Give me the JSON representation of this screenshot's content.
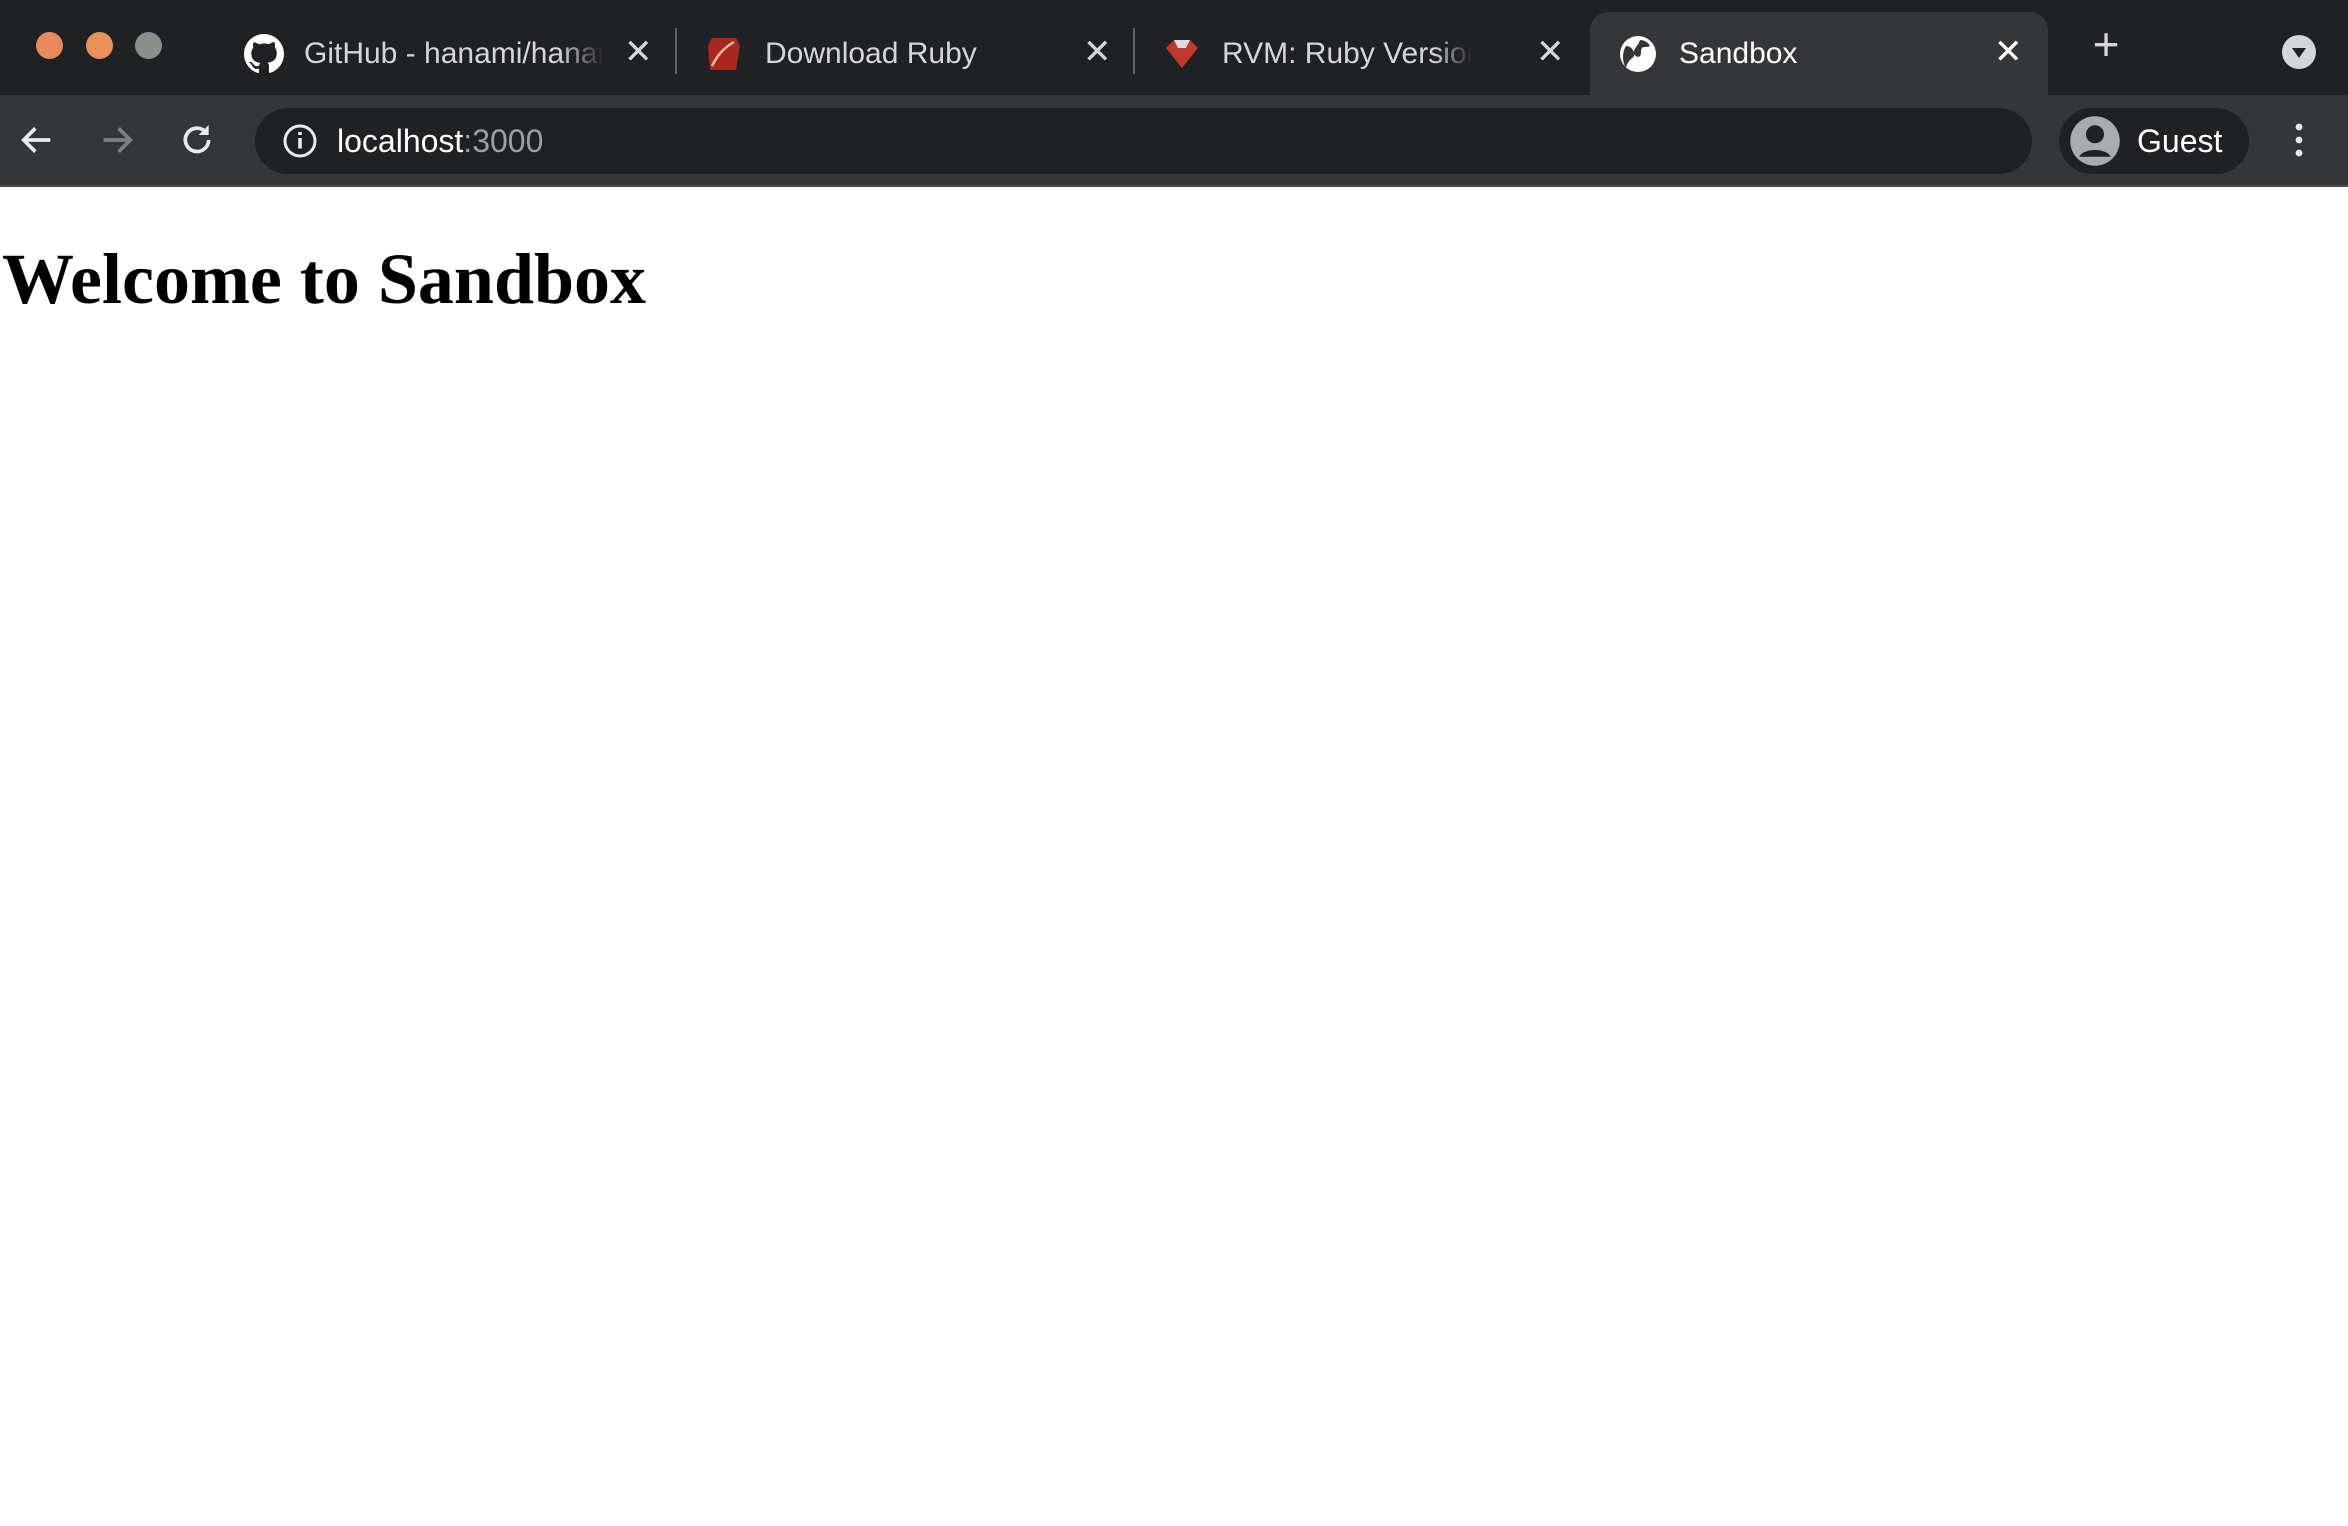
{
  "window_controls": {
    "close_color": "#e8895a",
    "minimize_color": "#e8905a",
    "maximize_color": "#8a8f8c"
  },
  "tabs": [
    {
      "title": "GitHub - hanami/hanami",
      "icon": "github-icon",
      "active": false
    },
    {
      "title": "Download Ruby",
      "icon": "ruby-icon",
      "active": false
    },
    {
      "title": "RVM: Ruby Version Manager",
      "icon": "rvm-icon",
      "active": false
    },
    {
      "title": "Sandbox",
      "icon": "globe-icon",
      "active": true
    }
  ],
  "toolbar": {
    "url_host": "localhost",
    "url_port": ":3000",
    "profile_label": "Guest"
  },
  "page": {
    "heading": "Welcome to Sandbox"
  }
}
